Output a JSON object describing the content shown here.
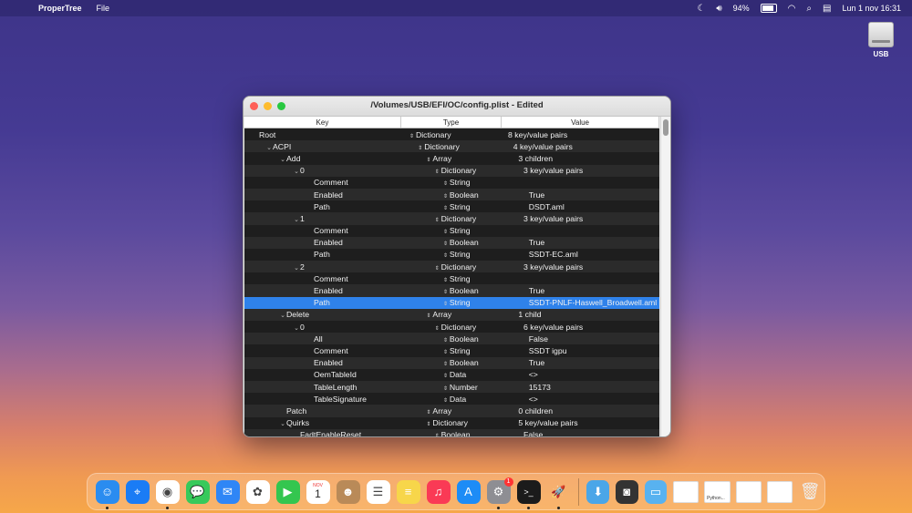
{
  "menubar": {
    "app_name": "ProperTree",
    "menus": [
      "File"
    ],
    "battery": "94%",
    "battery_level": 0.94,
    "datetime": "Lun 1 nov  16:31"
  },
  "desktop": {
    "usb_label": "USB"
  },
  "window": {
    "title": "/Volumes/USB/EFI/OC/config.plist - Edited",
    "columns": {
      "key": "Key",
      "type": "Type",
      "value": "Value"
    },
    "rows": [
      {
        "key": "Root",
        "type": "Dictionary",
        "value": "8 key/value pairs",
        "level": 0,
        "disc": ""
      },
      {
        "key": "ACPI",
        "type": "Dictionary",
        "value": "4 key/value pairs",
        "level": 1,
        "disc": "⌄"
      },
      {
        "key": "Add",
        "type": "Array",
        "value": "3 children",
        "level": 2,
        "disc": "⌄"
      },
      {
        "key": "0",
        "type": "Dictionary",
        "value": "3 key/value pairs",
        "level": 3,
        "disc": "⌄"
      },
      {
        "key": "Comment",
        "type": "String",
        "value": "",
        "level": 4,
        "disc": ""
      },
      {
        "key": "Enabled",
        "type": "Boolean",
        "value": "True",
        "level": 4,
        "disc": ""
      },
      {
        "key": "Path",
        "type": "String",
        "value": "DSDT.aml",
        "level": 4,
        "disc": ""
      },
      {
        "key": "1",
        "type": "Dictionary",
        "value": "3 key/value pairs",
        "level": 3,
        "disc": "⌄"
      },
      {
        "key": "Comment",
        "type": "String",
        "value": "",
        "level": 4,
        "disc": ""
      },
      {
        "key": "Enabled",
        "type": "Boolean",
        "value": "True",
        "level": 4,
        "disc": ""
      },
      {
        "key": "Path",
        "type": "String",
        "value": "SSDT-EC.aml",
        "level": 4,
        "disc": ""
      },
      {
        "key": "2",
        "type": "Dictionary",
        "value": "3 key/value pairs",
        "level": 3,
        "disc": "⌄"
      },
      {
        "key": "Comment",
        "type": "String",
        "value": "",
        "level": 4,
        "disc": ""
      },
      {
        "key": "Enabled",
        "type": "Boolean",
        "value": "True",
        "level": 4,
        "disc": ""
      },
      {
        "key": "Path",
        "type": "String",
        "value": "SSDT-PNLF-Haswell_Broadwell.aml",
        "level": 4,
        "disc": "",
        "selected": true
      },
      {
        "key": "Delete",
        "type": "Array",
        "value": "1 child",
        "level": 2,
        "disc": "⌄"
      },
      {
        "key": "0",
        "type": "Dictionary",
        "value": "6 key/value pairs",
        "level": 3,
        "disc": "⌄"
      },
      {
        "key": "All",
        "type": "Boolean",
        "value": "False",
        "level": 4,
        "disc": ""
      },
      {
        "key": "Comment",
        "type": "String",
        "value": "SSDT igpu",
        "level": 4,
        "disc": ""
      },
      {
        "key": "Enabled",
        "type": "Boolean",
        "value": "True",
        "level": 4,
        "disc": ""
      },
      {
        "key": "OemTableId",
        "type": "Data",
        "value": "<>",
        "level": 4,
        "disc": ""
      },
      {
        "key": "TableLength",
        "type": "Number",
        "value": "15173",
        "level": 4,
        "disc": ""
      },
      {
        "key": "TableSignature",
        "type": "Data",
        "value": "<>",
        "level": 4,
        "disc": ""
      },
      {
        "key": "Patch",
        "type": "Array",
        "value": "0 children",
        "level": 2,
        "disc": ""
      },
      {
        "key": "Quirks",
        "type": "Dictionary",
        "value": "5 key/value pairs",
        "level": 2,
        "disc": "⌄"
      },
      {
        "key": "FadtEnableReset",
        "type": "Boolean",
        "value": "False",
        "level": 3,
        "disc": ""
      }
    ]
  },
  "dock": {
    "apps": [
      {
        "name": "finder",
        "color": "#2a8cf0",
        "glyph": "☺",
        "running": true
      },
      {
        "name": "safari",
        "color": "#1a7cf5",
        "glyph": "⌖",
        "running": false
      },
      {
        "name": "chrome",
        "color": "#ffffff",
        "glyph": "◉",
        "running": true
      },
      {
        "name": "messages",
        "color": "#37c95b",
        "glyph": "💬",
        "running": false
      },
      {
        "name": "mail",
        "color": "#2f86f6",
        "glyph": "✉",
        "running": false
      },
      {
        "name": "photos",
        "color": "#ffffff",
        "glyph": "✿",
        "running": false
      },
      {
        "name": "facetime",
        "color": "#34c64f",
        "glyph": "▶",
        "running": false
      },
      {
        "name": "calendar",
        "color": "#ffffff",
        "glyph": "1",
        "running": false
      },
      {
        "name": "contacts",
        "color": "#b98a58",
        "glyph": "☻",
        "running": false
      },
      {
        "name": "reminders",
        "color": "#ffffff",
        "glyph": "☰",
        "running": false
      },
      {
        "name": "notes",
        "color": "#f7d64a",
        "glyph": "≡",
        "running": false
      },
      {
        "name": "music",
        "color": "#fa3a55",
        "glyph": "♫",
        "running": false
      },
      {
        "name": "app-store",
        "color": "#1d8cf6",
        "glyph": "A",
        "running": false
      },
      {
        "name": "system-preferences",
        "color": "#8e8e93",
        "glyph": "⚙",
        "running": true,
        "badge": "1"
      },
      {
        "name": "terminal",
        "color": "#1b1b1b",
        "glyph": ">_",
        "running": true
      },
      {
        "name": "rocket",
        "color": "transparent",
        "glyph": "🚀",
        "running": true
      }
    ],
    "calendar_month": "NOV",
    "calendar_day": "1",
    "python_label": "Python..."
  }
}
